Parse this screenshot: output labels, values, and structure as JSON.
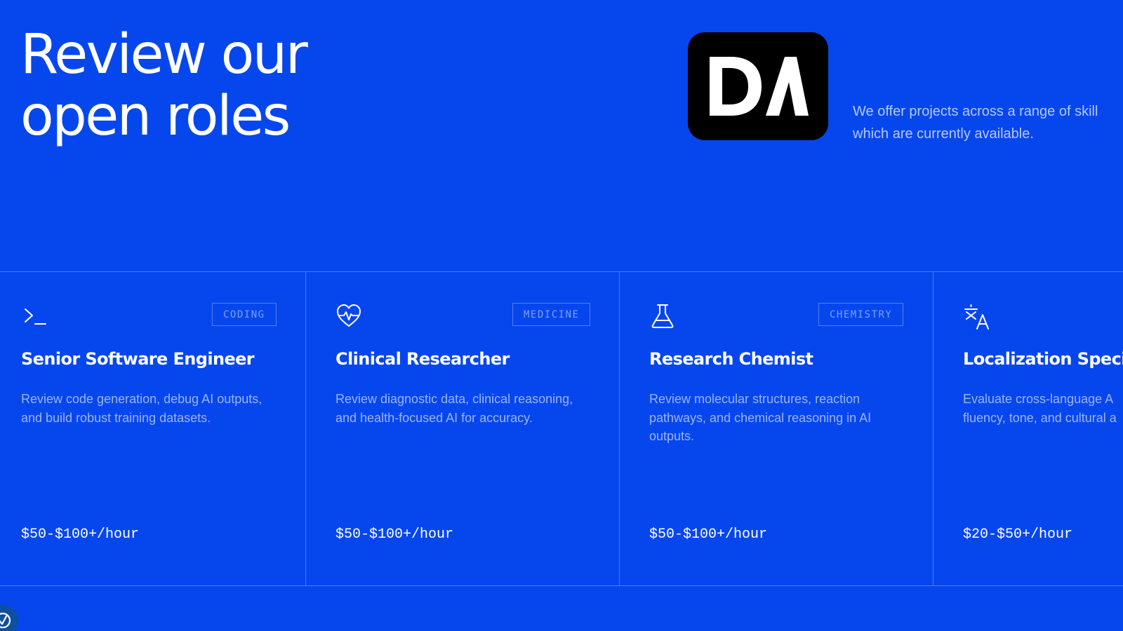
{
  "hero": {
    "title_line1": "Review our",
    "title_line2": "open roles"
  },
  "logo": {
    "text": "DA"
  },
  "intro": {
    "line1": "We offer projects across a range of skill",
    "line2": "which are currently available."
  },
  "colors": {
    "background": "#0647ed",
    "text": "#ffffff",
    "muted_text": "#9cb4ff",
    "tag_text": "#7f9ef7",
    "logo_bg": "#000000"
  },
  "roles": [
    {
      "icon": "terminal-icon",
      "tag": "CODING",
      "title": "Senior Software Engineer",
      "description": "Review code generation, debug AI outputs, and build robust training datasets.",
      "rate": "$50-$100+/hour"
    },
    {
      "icon": "heart-pulse-icon",
      "tag": "MEDICINE",
      "title": "Clinical Researcher",
      "description": "Review diagnostic data, clinical reasoning, and health-focused AI for accuracy.",
      "rate": "$50-$100+/hour"
    },
    {
      "icon": "flask-icon",
      "tag": "CHEMISTRY",
      "title": "Research Chemist",
      "description": "Review molecular structures, reaction pathways, and chemical reasoning in AI outputs.",
      "rate": "$50-$100+/hour"
    },
    {
      "icon": "translate-icon",
      "title": "Localization Specia",
      "description_line1": "Evaluate cross-language A",
      "description_line2": "fluency, tone, and cultural a",
      "rate": "$20-$50+/hour"
    }
  ]
}
